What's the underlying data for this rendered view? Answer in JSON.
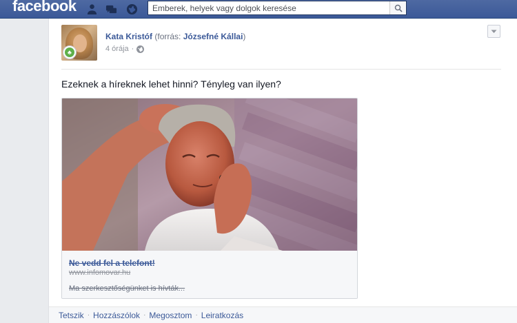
{
  "topbar": {
    "logo": "facebook",
    "search_placeholder": "Emberek, helyek vagy dolgok keresése"
  },
  "post": {
    "author": "Kata Kristóf",
    "via_prefix": "(forrás: ",
    "via_source": "Józsefné Kállai",
    "via_suffix": ")",
    "time": "4 órája",
    "privacy_icon": "globe-icon",
    "message": "Ezeknek a híreknek lehet hinni? Tényleg van ilyen?",
    "link": {
      "title": "Ne vedd fel a telefont!",
      "domain": "www.infomovar.hu",
      "description": "Ma szerkesztőségünket is hívták..."
    },
    "actions": [
      "Tetszik",
      "Hozzászólok",
      "Megosztom",
      "Leiratkozás"
    ]
  },
  "colors": {
    "brand": "#3b5998",
    "link": "#3b5998",
    "meta": "#90949c"
  }
}
